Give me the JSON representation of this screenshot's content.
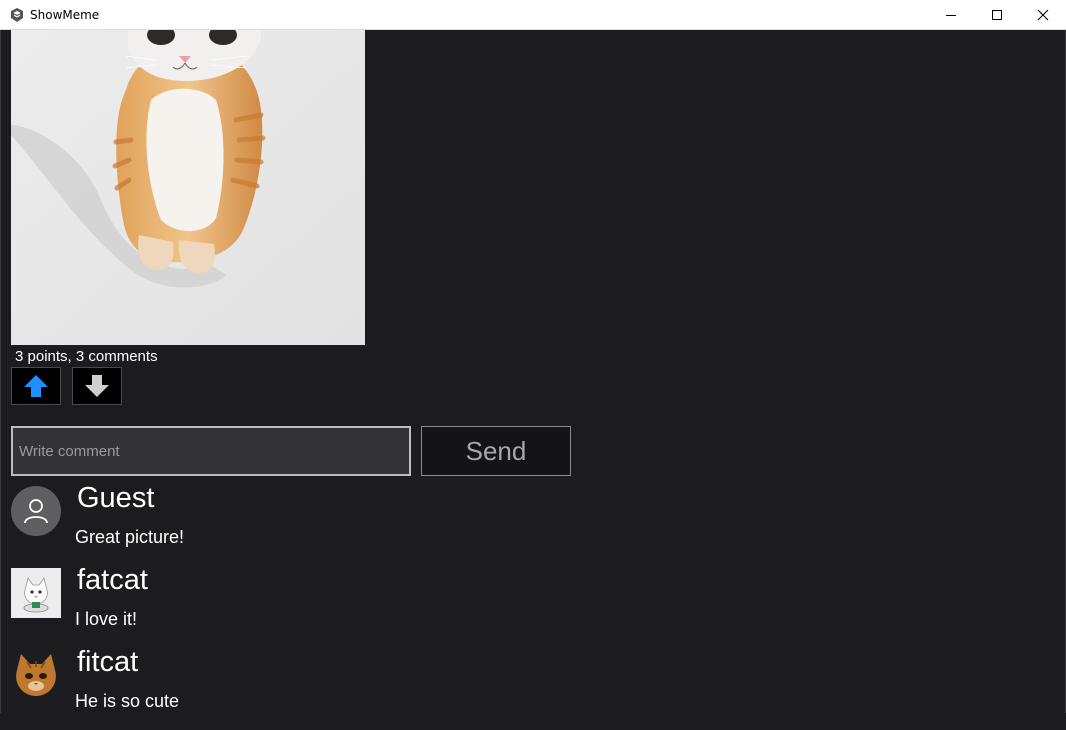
{
  "window": {
    "title": "ShowMeme",
    "app_icon": "showmeme-logo-icon",
    "controls": [
      "minimize-icon",
      "maximize-icon",
      "close-icon"
    ]
  },
  "post": {
    "image": "orange-tabby-kitten-standing",
    "stats": "3 points, 3 comments",
    "upvote_icon": "arrow-up-icon",
    "downvote_icon": "arrow-down-icon",
    "upvote_color": "#1e90ff"
  },
  "comment_form": {
    "placeholder": "Write comment",
    "value": "",
    "send_label": "Send"
  },
  "comments": [
    {
      "user": "Guest",
      "text": "Great picture!",
      "avatar": "default-user-icon"
    },
    {
      "user": "fatcat",
      "text": "I love it!",
      "avatar": "white-cat-avatar"
    },
    {
      "user": "fitcat",
      "text": "He is so cute",
      "avatar": "orange-cat-avatar"
    }
  ]
}
